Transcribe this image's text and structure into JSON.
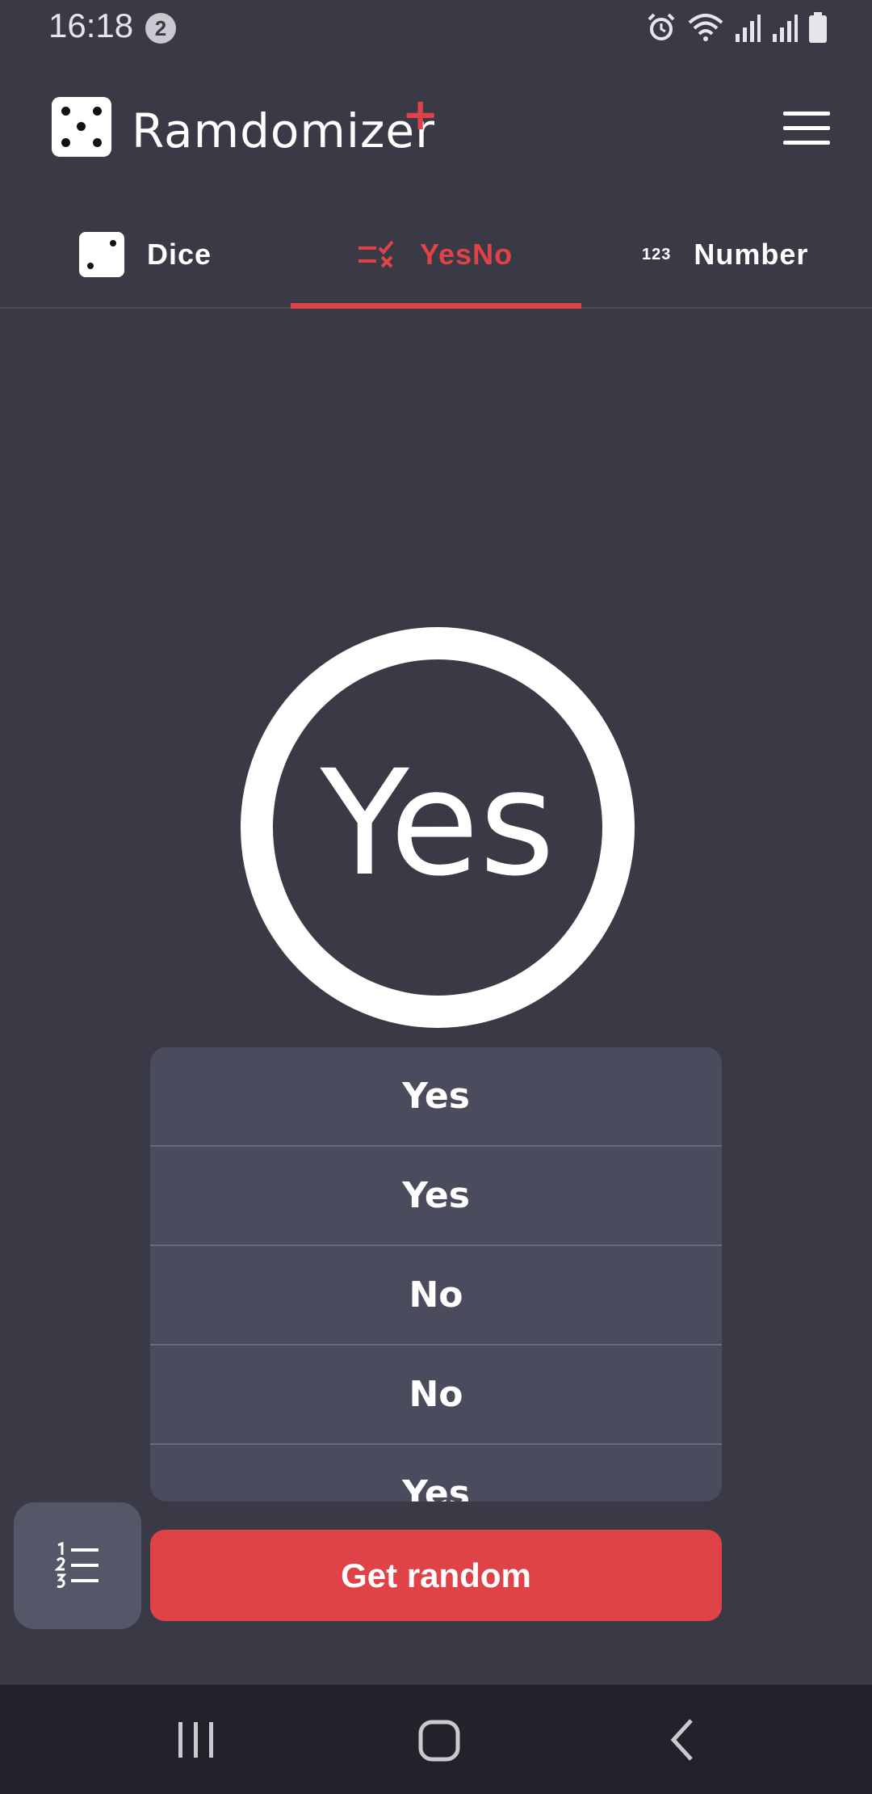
{
  "status_bar": {
    "time": "16:18",
    "notification_count": "2"
  },
  "header": {
    "app_name": "Ramdomizer",
    "app_name_suffix": "+"
  },
  "tabs": [
    {
      "label": "Dice",
      "icon": "dice-icon",
      "selected": false
    },
    {
      "label": "YesNo",
      "icon": "yesno-icon",
      "selected": true
    },
    {
      "label": "Number",
      "icon": "number-123-icon",
      "icon_text": "123",
      "selected": false
    }
  ],
  "result": {
    "value": "Yes"
  },
  "history": [
    "Yes",
    "Yes",
    "No",
    "No",
    "Yes"
  ],
  "actions": {
    "get_random_label": "Get random"
  },
  "colors": {
    "background": "#393a45",
    "accent": "#e04347",
    "list_background": "#4a4c5e",
    "nav_bar": "#22222a"
  }
}
